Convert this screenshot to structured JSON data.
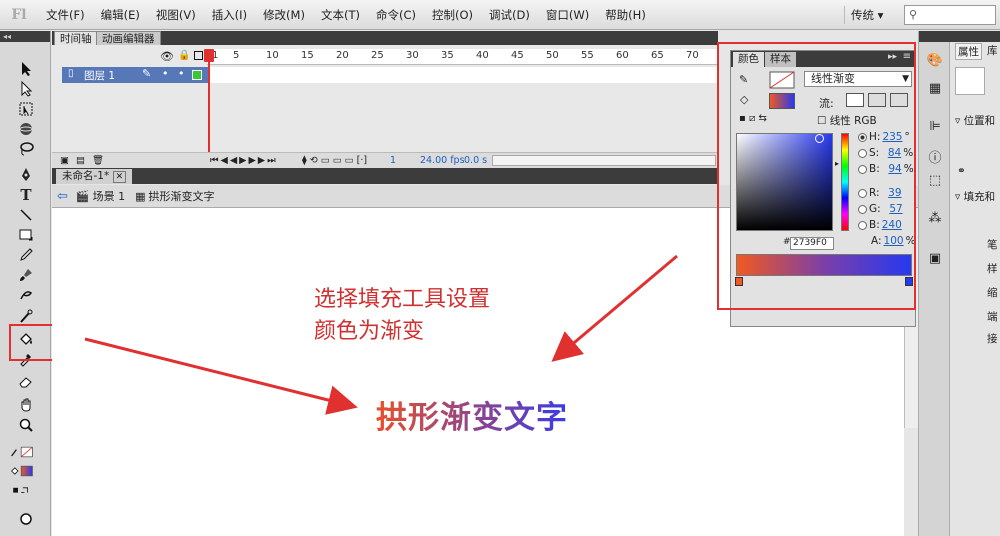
{
  "menu": [
    "文件(F)",
    "编辑(E)",
    "视图(V)",
    "插入(I)",
    "修改(M)",
    "文本(T)",
    "命令(C)",
    "控制(O)",
    "调试(D)",
    "窗口(W)",
    "帮助(H)"
  ],
  "app_logo": "Fl",
  "workspace": "传统 ▾",
  "timeline": {
    "tabs": [
      "时间轴",
      "动画编辑器"
    ],
    "frame_labels": [
      "1",
      "5",
      "10",
      "15",
      "20",
      "25",
      "30",
      "35",
      "40",
      "45",
      "50",
      "55",
      "60",
      "65",
      "70"
    ],
    "layer_name": "图层 1",
    "current_frame": "1",
    "fps": "24.00 fps",
    "time": "0.0 s"
  },
  "document": {
    "tab": "未命名-1*",
    "breadcrumb_scene": "场景 1",
    "breadcrumb_symbol": "拱形渐变文字"
  },
  "stage": {
    "annotation_line1": "选择填充工具设置",
    "annotation_line2": "颜色为渐变",
    "gradient_text": "拱形渐变文字"
  },
  "color_panel": {
    "tabs": [
      "颜色",
      "样本"
    ],
    "type": "线性渐变",
    "flow_label": "流:",
    "linear_rgb": "线性 RGB",
    "hex": "2739F0",
    "fields": [
      {
        "label": "H:",
        "value": "235",
        "unit": "°",
        "selected": true
      },
      {
        "label": "S:",
        "value": "84",
        "unit": "%",
        "selected": false
      },
      {
        "label": "B:",
        "value": "94",
        "unit": "%",
        "selected": false
      },
      {
        "label": "R:",
        "value": "39",
        "unit": "",
        "selected": false
      },
      {
        "label": "G:",
        "value": "57",
        "unit": "",
        "selected": false
      },
      {
        "label": "B:",
        "value": "240",
        "unit": "",
        "selected": false
      }
    ],
    "alpha_label": "A:",
    "alpha_value": "100",
    "alpha_unit": "%",
    "gradient_start": "#f05a20",
    "gradient_end": "#2739f0"
  },
  "properties": {
    "tabs": [
      "属性",
      "库"
    ],
    "labels": [
      "位置和",
      "填充和",
      "笔",
      "样",
      "缩",
      "端",
      "接"
    ]
  },
  "colors": {
    "annotation_red": "#e03030",
    "layer_blue": "#5677b8"
  }
}
